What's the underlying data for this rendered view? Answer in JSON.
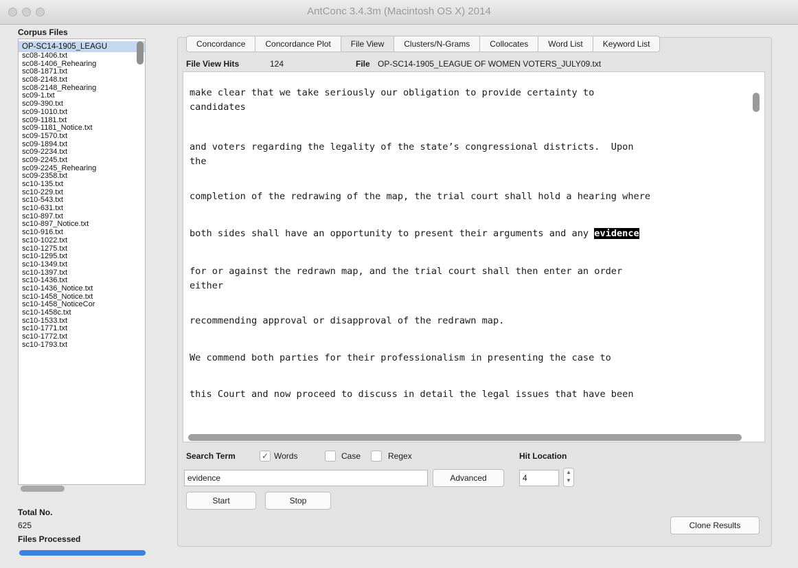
{
  "window": {
    "title": "AntConc 3.4.3m (Macintosh OS X) 2014"
  },
  "sidebar": {
    "corpus_files_label": "Corpus Files",
    "files": [
      "OP-SC14-1905_LEAGU",
      "sc08-1406.txt",
      "sc08-1406_Rehearing",
      "sc08-1871.txt",
      "sc08-2148.txt",
      "sc08-2148_Rehearing",
      "sc09-1.txt",
      "sc09-390.txt",
      "sc09-1010.txt",
      "sc09-1181.txt",
      "sc09-1181_Notice.txt",
      "sc09-1570.txt",
      "sc09-1894.txt",
      "sc09-2234.txt",
      "sc09-2245.txt",
      "sc09-2245_Rehearing",
      "sc09-2358.txt",
      "sc10-135.txt",
      "sc10-229.txt",
      "sc10-543.txt",
      "sc10-631.txt",
      "sc10-897.txt",
      "sc10-897_Notice.txt",
      "sc10-916.txt",
      "sc10-1022.txt",
      "sc10-1275.txt",
      "sc10-1295.txt",
      "sc10-1349.txt",
      "sc10-1397.txt",
      "sc10-1436.txt",
      "sc10-1436_Notice.txt",
      "sc10-1458_Notice.txt",
      "sc10-1458_NoticeCor",
      "sc10-1458c.txt",
      "sc10-1533.txt",
      "sc10-1771.txt",
      "sc10-1772.txt",
      "sc10-1793.txt"
    ],
    "total_no_label": "Total No.",
    "total_no_value": "625",
    "files_processed_label": "Files Processed",
    "files_processed_progress": 1.0
  },
  "tabs": [
    "Concordance",
    "Concordance Plot",
    "File View",
    "Clusters/N-Grams",
    "Collocates",
    "Word List",
    "Keyword List"
  ],
  "active_tab": "File View",
  "file_view": {
    "hits_label": "File View Hits",
    "hits_value": "124",
    "file_label": "File",
    "file_value": "OP-SC14-1905_LEAGUE OF WOMEN VOTERS_JULY09.txt",
    "lines": {
      "l1": "make clear that we take seriously our obligation to provide certainty to",
      "l2": "candidates",
      "l3": "and voters regarding the legality of the state’s congressional districts.  Upon",
      "l4": "the",
      "l5": "completion of the redrawing of the map, the trial court shall hold a hearing where",
      "l6_before": "both sides shall have an opportunity to present their arguments and any ",
      "l6_hit": "evidence",
      "l7": "for or against the redrawn map, and the trial court shall then enter an order",
      "l8": "either",
      "l9": "recommending approval or disapproval of the redrawn map.",
      "l10": "We commend both parties for their professionalism in presenting the case to",
      "l11": "this Court and now proceed to discuss in detail the legal issues that have been"
    }
  },
  "search": {
    "search_term_label": "Search Term",
    "words_label": "Words",
    "words_checked": true,
    "case_label": "Case",
    "case_checked": false,
    "regex_label": "Regex",
    "regex_checked": false,
    "term_value": "evidence",
    "advanced_label": "Advanced",
    "hit_location_label": "Hit Location",
    "hit_location_value": "4",
    "start_label": "Start",
    "stop_label": "Stop",
    "clone_results_label": "Clone Results"
  }
}
